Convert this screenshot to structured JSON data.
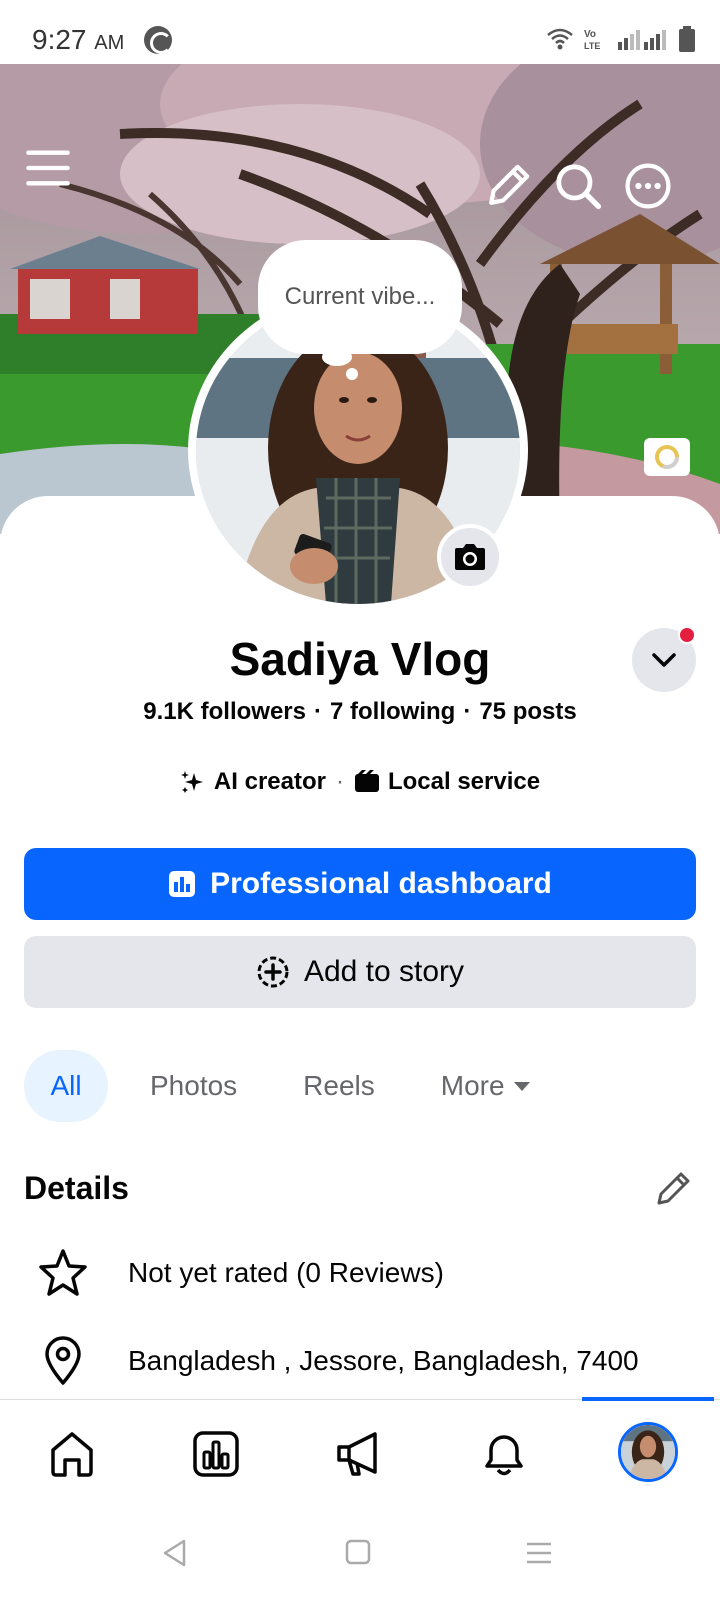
{
  "status_bar": {
    "time": "9:27",
    "ampm": "AM",
    "icons": [
      "notification-app-icon",
      "wifi-icon",
      "volte-icon",
      "signal-icon",
      "battery-icon"
    ]
  },
  "cover": {
    "icons": [
      "menu-icon",
      "edit-pencil-icon",
      "search-icon",
      "more-options-icon",
      "cover-camera-icon"
    ]
  },
  "thought_bubble": {
    "text": "Current vibe..."
  },
  "profile": {
    "name": "Sadiya Vlog",
    "followers": "9.1K followers",
    "following": "7 following",
    "posts": "75 posts",
    "category_1": "AI creator",
    "category_2": "Local service"
  },
  "actions": {
    "primary_label": "Professional dashboard",
    "secondary_label": "Add to story"
  },
  "tabs": [
    {
      "label": "All",
      "active": true
    },
    {
      "label": "Photos",
      "active": false
    },
    {
      "label": "Reels",
      "active": false
    },
    {
      "label": "More",
      "active": false
    }
  ],
  "details": {
    "title": "Details",
    "rating": "Not yet rated (0 Reviews)",
    "location": "Bangladesh , Jessore, Bangladesh, 7400"
  },
  "bottom_nav": {
    "items": [
      "home-icon",
      "insights-icon",
      "megaphone-icon",
      "notifications-icon",
      "profile-avatar"
    ],
    "active": "profile-avatar"
  },
  "colors": {
    "accent": "#0866ff",
    "secondary_button": "#e4e6eb",
    "active_tab_bg": "#e7f3ff",
    "notification_dot": "#e41e3f"
  }
}
